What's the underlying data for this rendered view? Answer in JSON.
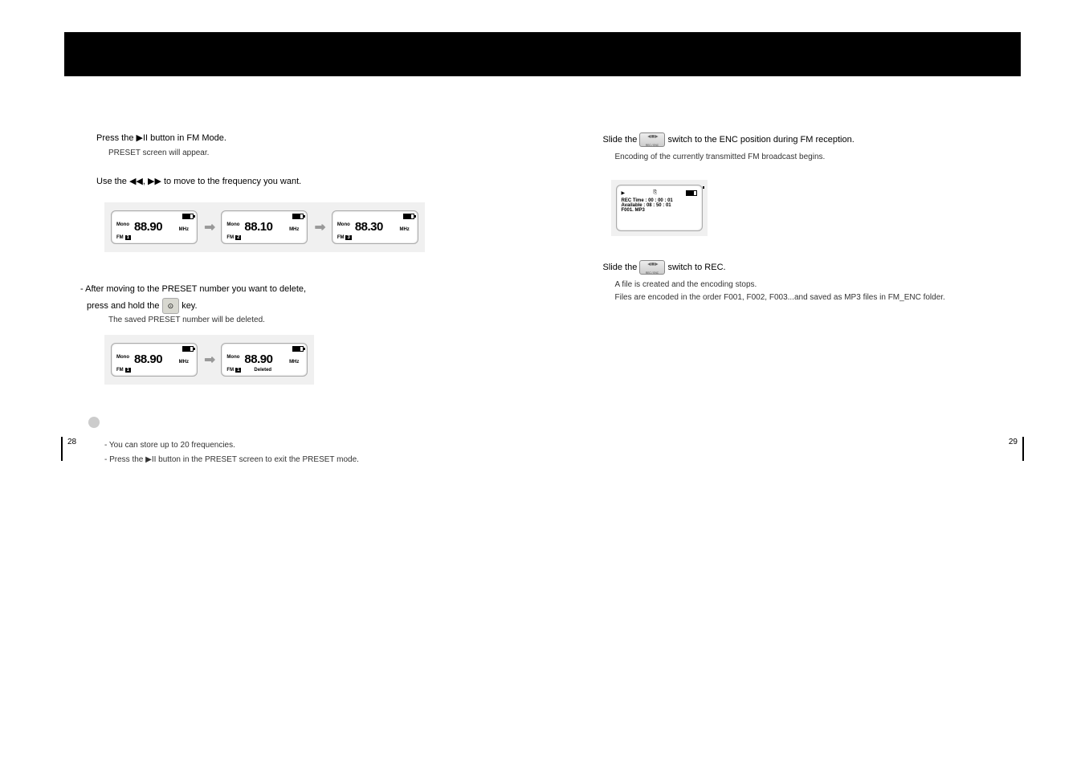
{
  "left": {
    "step1": "Press the ▶II button in FM Mode.",
    "step1_sub": "PRESET screen will appear.",
    "step2": "Use the ◀◀, ▶▶ to move to the frequency you want.",
    "screens_row1": [
      {
        "mode": "Mono",
        "freq": "88.90",
        "unit": "MHz",
        "fm": "FM",
        "preset": "1"
      },
      {
        "mode": "Mono",
        "freq": "88.10",
        "unit": "MHz",
        "fm": "FM",
        "preset": "2"
      },
      {
        "mode": "Mono",
        "freq": "88.30",
        "unit": "MHz",
        "fm": "FM",
        "preset": "3"
      }
    ],
    "delete_title": "- After moving to the PRESET number you want to delete,",
    "delete_title2": "press and hold the",
    "delete_title3": "key.",
    "delete_sub": "The saved PRESET number will be deleted.",
    "screens_row2": [
      {
        "mode": "Mono",
        "freq": "88.90",
        "unit": "MHz",
        "fm": "FM",
        "preset": "1",
        "deleted": ""
      },
      {
        "mode": "Mono",
        "freq": "88.90",
        "unit": "MHz",
        "fm": "FM",
        "preset": "1",
        "deleted": "Deleted"
      }
    ],
    "note1": "- You can store up to 20 frequencies.",
    "note2": "- Press the ▶II button in the PRESET screen to exit the PRESET mode."
  },
  "right": {
    "step1a": "Slide the",
    "step1b": "switch to the ENC position during FM reception.",
    "step1_sub": "Encoding of the currently transmitted FM broadcast begins.",
    "rec_screen": {
      "line1": "REC Time : 00 : 00 : 01",
      "line2": "Available : 08 : 50 : 01",
      "line3": "F001. MP3"
    },
    "step2a": "Slide the",
    "step2b": "switch to REC.",
    "step2_sub1": "A file is created and the encoding stops.",
    "step2_sub2": "Files are encoded in the order F001, F002, F003...and saved as MP3 files in FM_ENC folder."
  },
  "pages": {
    "left": "28",
    "right": "29"
  },
  "icons": {
    "button_key": "⊙"
  }
}
